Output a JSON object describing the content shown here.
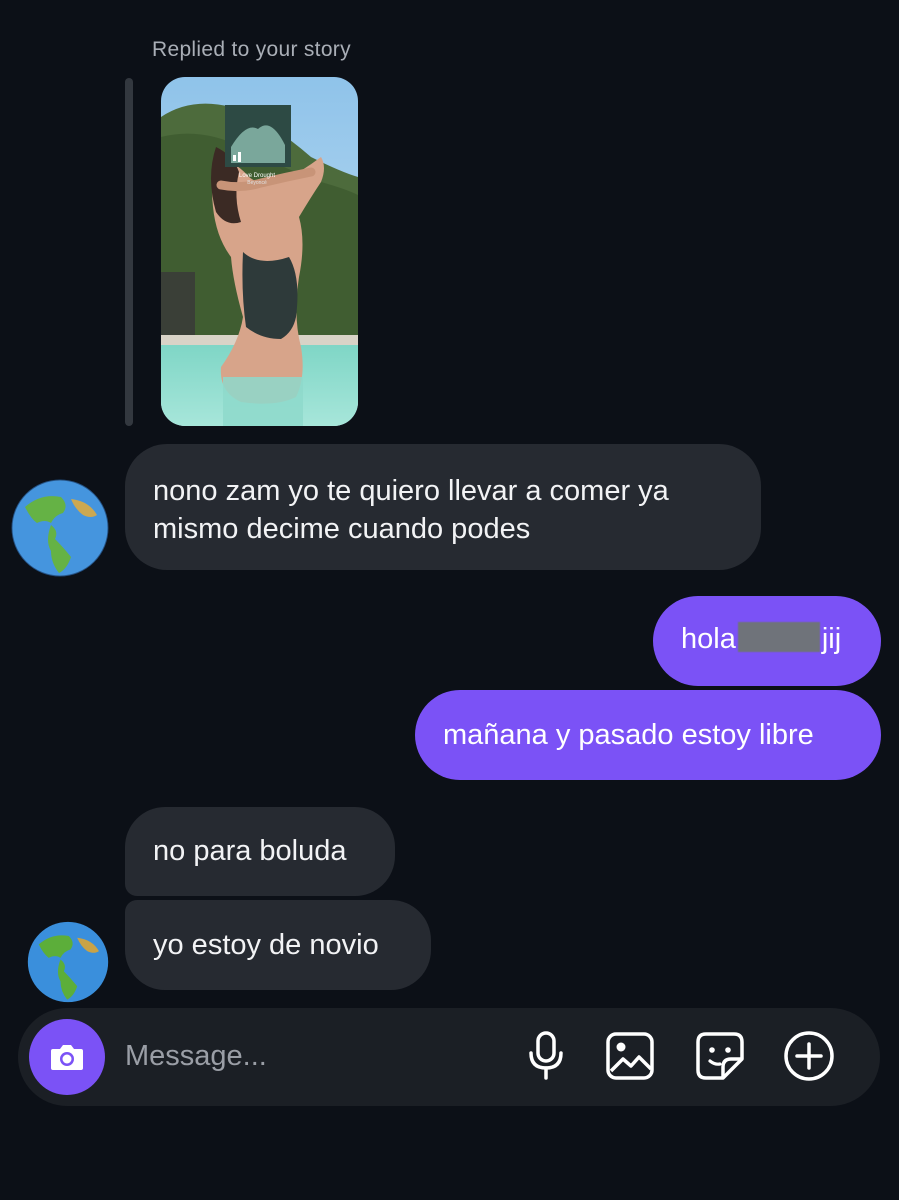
{
  "reply": {
    "caption": "Replied to your story"
  },
  "story_music": {
    "title": "Love Drought",
    "artist": "Beyoncé"
  },
  "messages": [
    {
      "side": "in",
      "text": "nono zam yo te quiero llevar a comer ya mismo decime cuando podes"
    },
    {
      "side": "out",
      "text_before": "hola",
      "text_after": "jij"
    },
    {
      "side": "out",
      "text": "mañana y pasado estoy libre"
    },
    {
      "side": "in",
      "text": "no para boluda"
    },
    {
      "side": "in",
      "text": "yo estoy de novio"
    }
  ],
  "composer": {
    "placeholder": "Message...",
    "icons": [
      "camera-icon",
      "microphone-icon",
      "gallery-icon",
      "sticker-icon",
      "add-icon"
    ]
  },
  "colors": {
    "background": "#0c1017",
    "incoming_bubble": "#262a31",
    "outgoing_bubble": "#7b52f6",
    "composer": "#1b1f25"
  }
}
